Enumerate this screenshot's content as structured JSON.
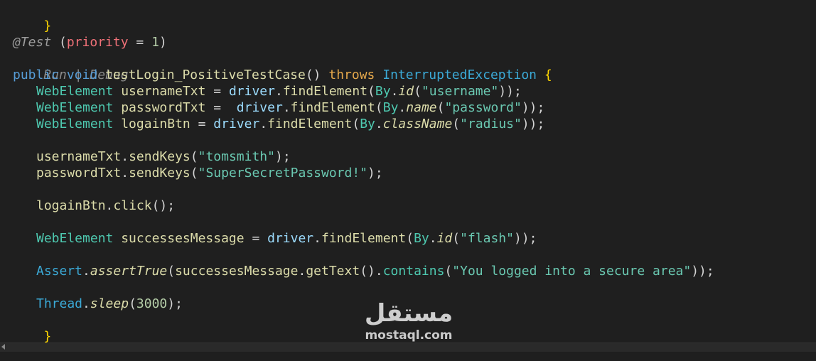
{
  "code": {
    "l1": "}",
    "l3": {
      "ann": "@Test",
      "open": " (",
      "prio": "priority",
      "eq": " = ",
      "num": "1",
      "close": ")"
    },
    "codelens": "Run | Debug",
    "l5": {
      "kw1": "public",
      "kw2": "void",
      "fn": "testLogin_PositiveTestCase",
      "paren": "()",
      "throws": "throws",
      "exc": "InterruptedException",
      "brace": "{"
    },
    "l6": {
      "type": "WebElement",
      "var": "usernameTxt",
      "eq": " = ",
      "drv": "driver",
      "dot1": ".",
      "fn": "findElement",
      "op": "(",
      "by": "By",
      "dot2": ".",
      "m": "id",
      "op2": "(",
      "str": "\"username\"",
      "cl": "));"
    },
    "l7": {
      "type": "WebElement",
      "var": "passwordTxt",
      "eq": " =  ",
      "drv": "driver",
      "dot1": ".",
      "fn": "findElement",
      "op": "(",
      "by": "By",
      "dot2": ".",
      "m": "name",
      "op2": "(",
      "str": "\"password\"",
      "cl": "));"
    },
    "l8": {
      "type": "WebElement",
      "var": "logainBtn",
      "eq": " = ",
      "drv": "driver",
      "dot1": ".",
      "fn": "findElement",
      "op": "(",
      "by": "By",
      "dot2": ".",
      "m": "className",
      "op2": "(",
      "str": "\"radius\"",
      "cl": "));"
    },
    "l10": {
      "var": "usernameTxt",
      "dot": ".",
      "fn": "sendKeys",
      "op": "(",
      "str": "\"tomsmith\"",
      "cl": ");"
    },
    "l11": {
      "var": "passwordTxt",
      "dot": ".",
      "fn": "sendKeys",
      "op": "(",
      "str": "\"SuperSecretPassword!\"",
      "cl": ");"
    },
    "l13": {
      "var": "logainBtn",
      "dot": ".",
      "fn": "click",
      "cl": "();"
    },
    "l15": {
      "type": "WebElement",
      "var": "successesMessage",
      "eq": " = ",
      "drv": "driver",
      "dot1": ".",
      "fn": "findElement",
      "op": "(",
      "by": "By",
      "dot2": ".",
      "m": "id",
      "op2": "(",
      "str": "\"flash\"",
      "cl": "));"
    },
    "l17": {
      "cls": "Assert",
      "dot": ".",
      "fn": "assertTrue",
      "op": "(",
      "var": "successesMessage",
      "dot2": ".",
      "fn2": "getText",
      "p": "()",
      "dot3": ".",
      "fn3": "contains",
      "op2": "(",
      "str": "\"You logged into a secure area\"",
      "cl": "));"
    },
    "l19": {
      "cls": "Thread",
      "dot": ".",
      "fn": "sleep",
      "op": "(",
      "num": "3000",
      "cl": ");"
    },
    "l20": "}"
  },
  "watermark": {
    "logo": "مستقل",
    "text": "mostaql.com"
  },
  "colors": {
    "background": "#1f1f1f",
    "string": "#6ac8b1",
    "type": "#4ec9b0",
    "keyword": "#c586c0"
  }
}
